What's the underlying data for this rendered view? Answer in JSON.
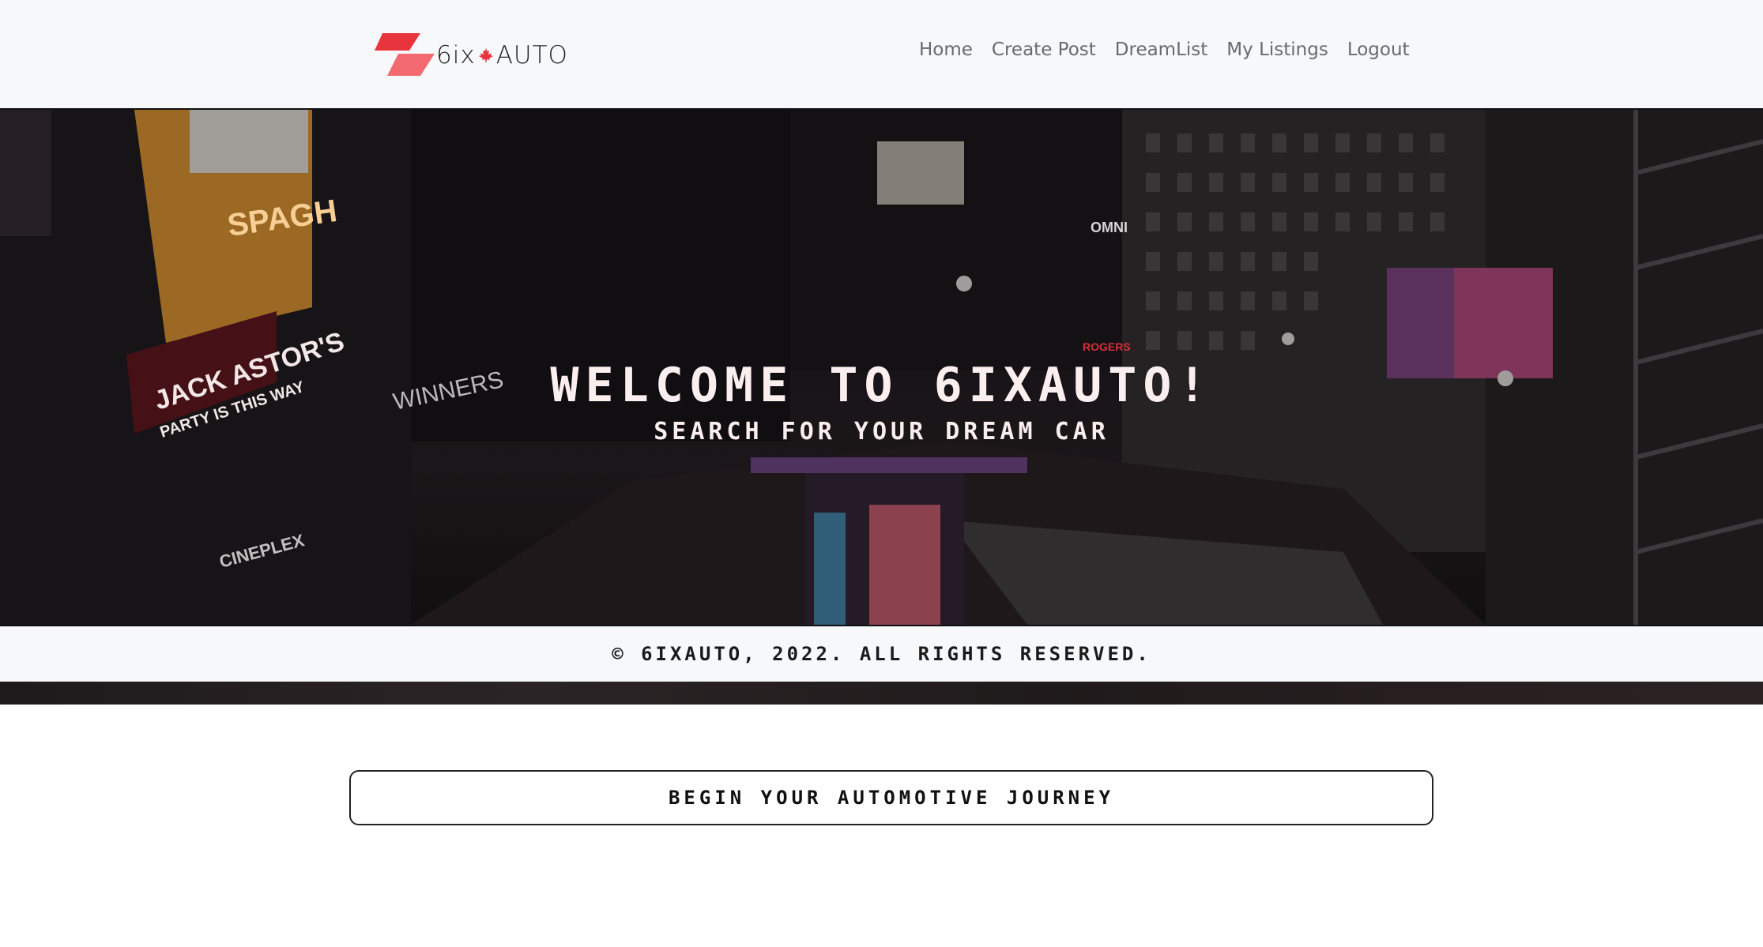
{
  "brand": {
    "name_left": "6ix",
    "name_right": "AUTO",
    "accent": "#e8343c",
    "accent_light": "#f26a6f"
  },
  "nav": {
    "items": [
      {
        "label": "Home"
      },
      {
        "label": "Create Post"
      },
      {
        "label": "DreamList"
      },
      {
        "label": "My Listings"
      },
      {
        "label": "Logout"
      }
    ]
  },
  "hero": {
    "title": "WELCOME TO 6IXAUTO!",
    "subtitle": "SEARCH FOR YOUR DREAM CAR",
    "signs": {
      "jack": "JACK ASTOR'S",
      "jack_sub": "PARTY IS THIS WAY",
      "winners": "WINNERS",
      "cineplex": "CINEPLEX",
      "omni": "OMNI",
      "rogers": "ROGERS",
      "spa": "SPAGH"
    }
  },
  "footer": {
    "copyright": "© 6IXAUTO, 2022. ALL RIGHTS RESERVED."
  },
  "cta": {
    "label": "BEGIN YOUR AUTOMOTIVE JOURNEY"
  }
}
